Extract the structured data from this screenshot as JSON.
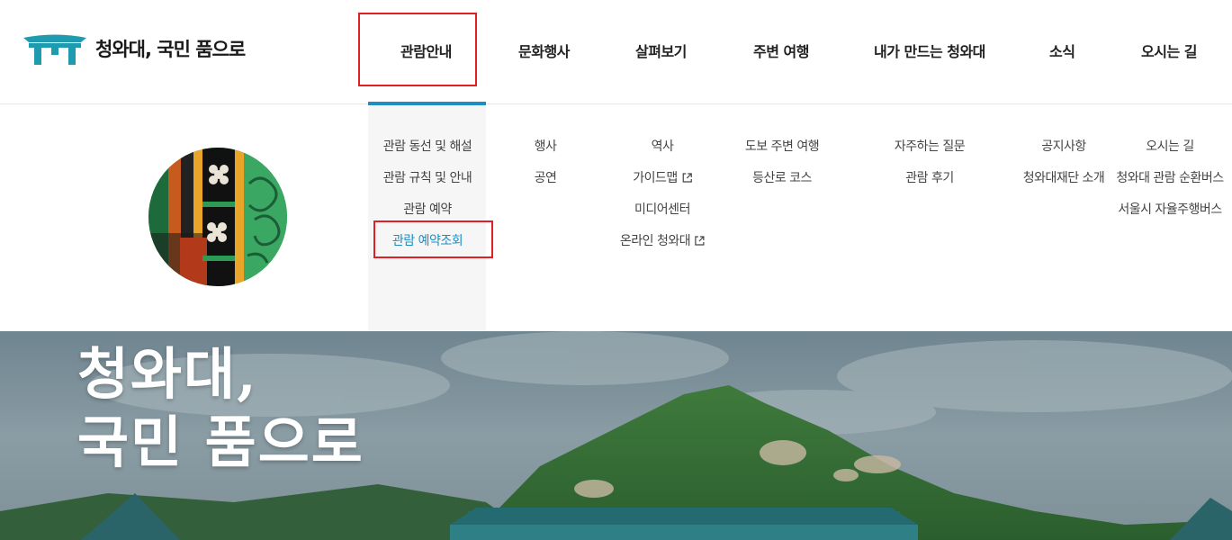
{
  "header": {
    "logo_text": "청와대, 국민 품으로",
    "nav": [
      {
        "label": "관람안내"
      },
      {
        "label": "문화행사"
      },
      {
        "label": "살펴보기"
      },
      {
        "label": "주변 여행"
      },
      {
        "label": "내가 만드는 청와대"
      },
      {
        "label": "소식"
      },
      {
        "label": "오시는 길"
      }
    ],
    "active_nav": "관람안내"
  },
  "mega_menu": {
    "columns": [
      {
        "items": [
          "관람 동선 및 해설",
          "관람 규칙 및 안내",
          "관람 예약",
          "관람 예약조회"
        ]
      },
      {
        "items": [
          "행사",
          "공연"
        ]
      },
      {
        "items": [
          "역사",
          "가이드맵",
          "미디어센터",
          "온라인 청와대"
        ]
      },
      {
        "items": [
          "도보 주변 여행",
          "등산로 코스"
        ]
      },
      {
        "items": [
          "자주하는 질문",
          "관람 후기"
        ]
      },
      {
        "items": [
          "공지사항",
          "청와대재단 소개"
        ]
      },
      {
        "items": [
          "오시는 길",
          "청와대 관람 순환버스",
          "서울시 자율주행버스"
        ]
      }
    ],
    "active_item": "관람 예약조회",
    "external_link_icons": [
      "가이드맵",
      "온라인 청와대"
    ]
  },
  "hero": {
    "title_line1": "청와대,",
    "title_line2": "국민 품으로"
  },
  "colors": {
    "accent": "#1e8ec2",
    "highlight_box": "#e41e26",
    "logo_teal": "#1f9bb0"
  }
}
